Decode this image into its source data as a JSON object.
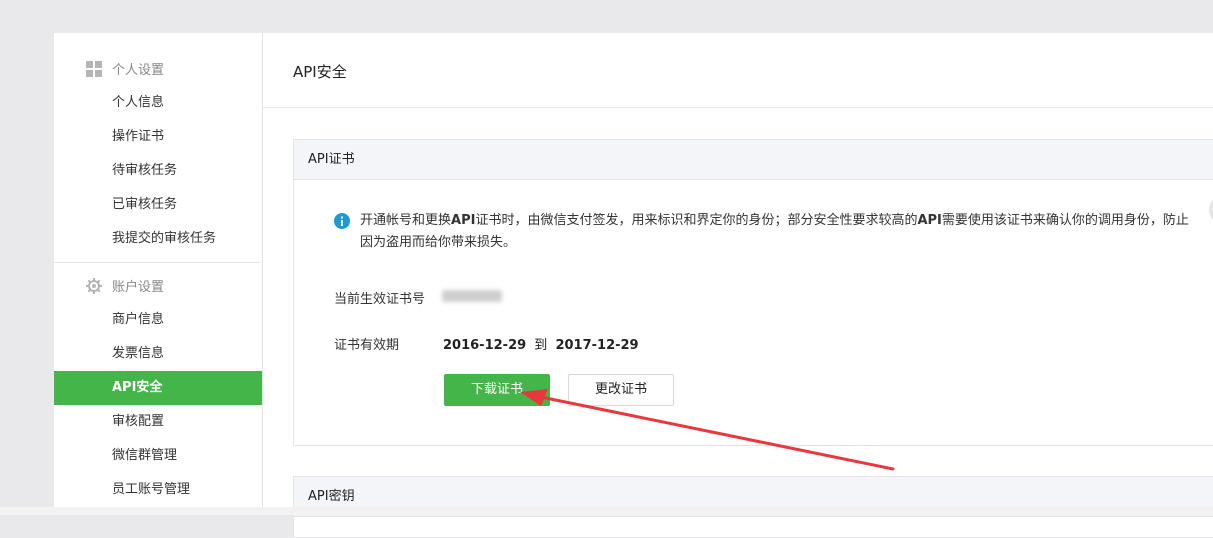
{
  "sidebar": {
    "personal_group": {
      "label": "个人设置",
      "icon": "grid-icon"
    },
    "personal_items": [
      {
        "label": "个人信息"
      },
      {
        "label": "操作证书"
      },
      {
        "label": "待审核任务"
      },
      {
        "label": "已审核任务"
      },
      {
        "label": "我提交的审核任务"
      }
    ],
    "account_group": {
      "label": "账户设置",
      "icon": "gear-icon"
    },
    "account_items": [
      {
        "label": "商户信息"
      },
      {
        "label": "发票信息"
      },
      {
        "label": "API安全",
        "active": true
      },
      {
        "label": "审核配置"
      },
      {
        "label": "微信群管理"
      },
      {
        "label": "员工账号管理"
      }
    ]
  },
  "main": {
    "title": "API安全",
    "cert_panel": {
      "heading": "API证书",
      "info_text_1": "开通帐号和更换",
      "info_bold_1": "API",
      "info_text_2": "证书时，由微信支付签发，用来标识和界定你的身份；部分安全性要求较高的",
      "info_bold_2": "API",
      "info_text_3": "需要使用该证书来确认你的调用身份，防止因为盗用而给你带来损失。",
      "current_cert_label": "当前生效证书号",
      "validity_label": "证书有效期",
      "valid_from": "2016-12-29",
      "valid_to_word": "到",
      "valid_to": "2017-12-29",
      "download_button": "下载证书",
      "change_button": "更改证书"
    },
    "key_panel": {
      "heading": "API密钥"
    }
  },
  "colors": {
    "accent": "#44b549",
    "info": "#1aad19",
    "annotation_arrow": "#e8383d"
  }
}
